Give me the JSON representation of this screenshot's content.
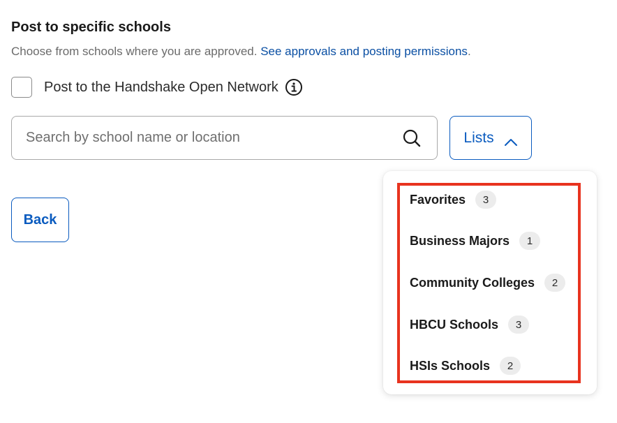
{
  "section": {
    "title": "Post to specific schools",
    "description": "Choose from schools where you are approved.",
    "approvals_link": "See approvals and posting permissions",
    "description_end": "."
  },
  "open_network": {
    "label": "Post to the Handshake Open Network",
    "checked": false,
    "info_icon": "info-icon"
  },
  "search": {
    "placeholder": "Search by school name or location",
    "value": "",
    "icon": "search-icon"
  },
  "lists_button": {
    "label": "Lists",
    "icon": "chevron-up-icon",
    "expanded": true
  },
  "back_button": {
    "label": "Back"
  },
  "lists_dropdown": {
    "items": [
      {
        "label": "Favorites",
        "count": "3"
      },
      {
        "label": "Business Majors",
        "count": "1"
      },
      {
        "label": "Community Colleges",
        "count": "2"
      },
      {
        "label": "HBCU Schools",
        "count": "3"
      },
      {
        "label": "HSIs Schools",
        "count": "2"
      }
    ]
  },
  "colors": {
    "accent": "#0a5bbf",
    "link": "#0a4fa3",
    "highlight": "#e8331f",
    "badge_bg": "#ececec"
  }
}
